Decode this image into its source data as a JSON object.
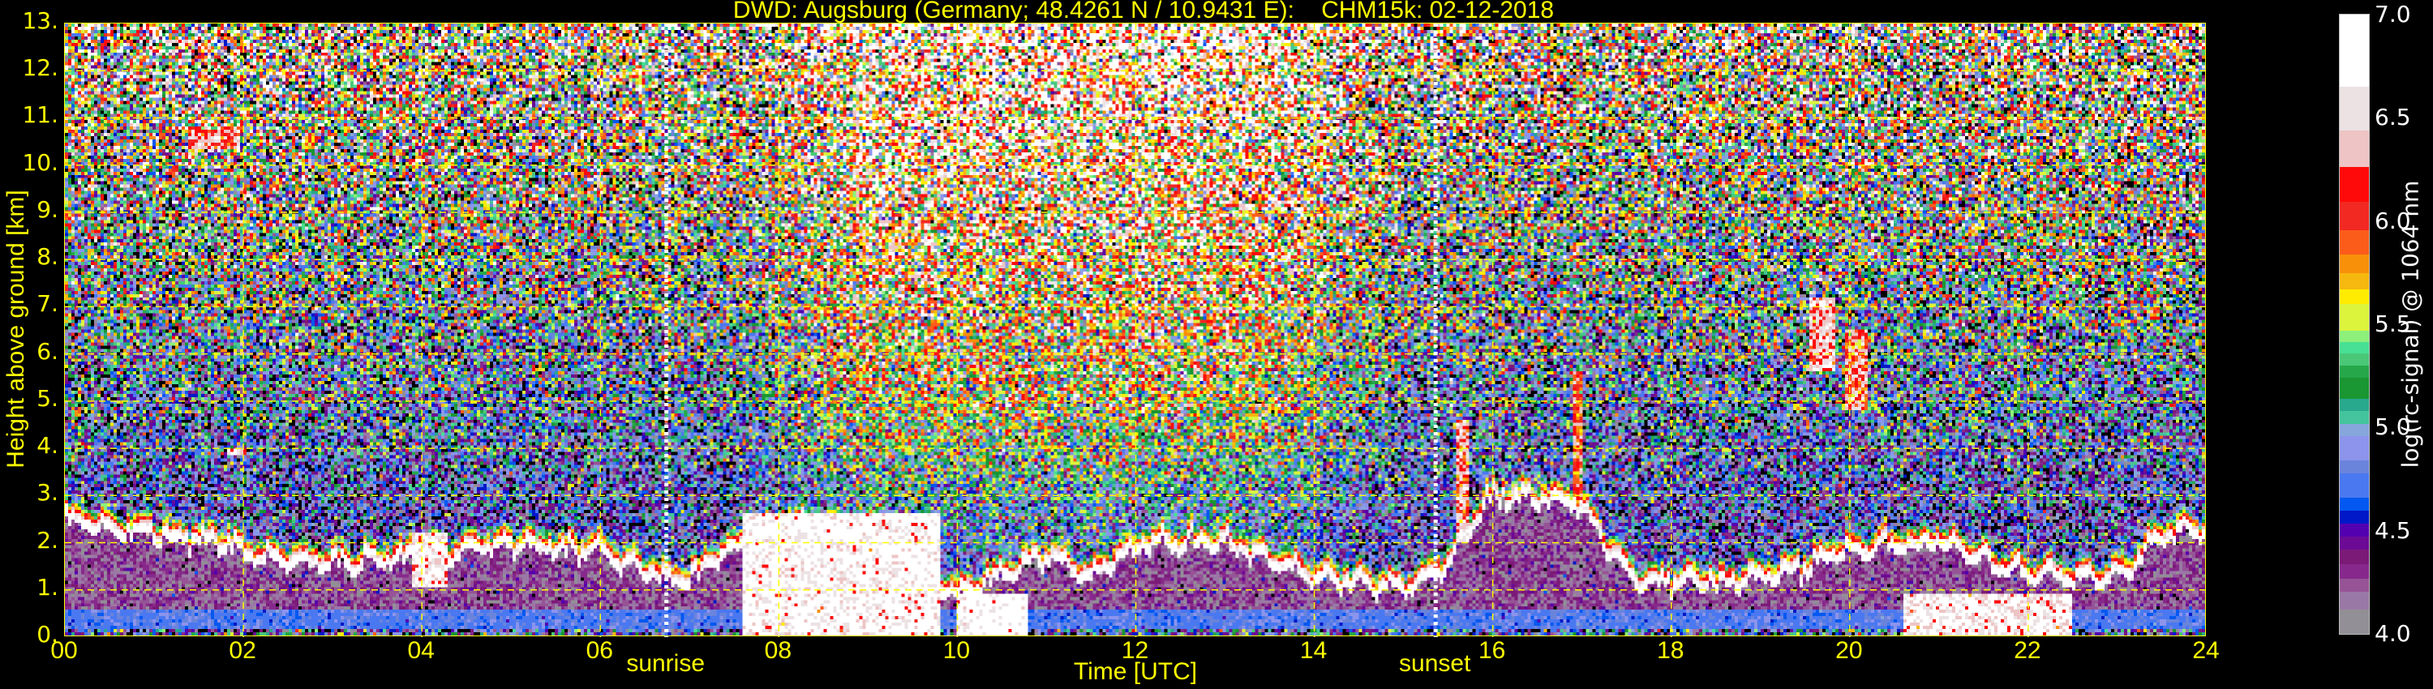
{
  "chart_data": {
    "type": "heatmap",
    "title": "DWD: Augsburg (Germany; 48.4261 N / 10.9431 E):    CHM15k: 02-12-2018",
    "xlabel": "Time [UTC]",
    "ylabel": "Height above ground [km]",
    "xlim": [
      0,
      24
    ],
    "ylim": [
      0,
      13
    ],
    "x_ticks": [
      "00",
      "02",
      "04",
      "06",
      "08",
      "10",
      "12",
      "14",
      "16",
      "18",
      "20",
      "22",
      "24"
    ],
    "y_ticks": [
      "0.",
      "1.",
      "2.",
      "3.",
      "4.",
      "5.",
      "6.",
      "7.",
      "8.",
      "9.",
      "10.",
      "11.",
      "12.",
      "13."
    ],
    "grid": true,
    "grid_color": "#ffff00",
    "markers": [
      {
        "label": "sunrise",
        "time_h": 6.74
      },
      {
        "label": "sunset",
        "time_h": 15.36
      }
    ],
    "colorbar": {
      "label": "log(rc-signal) @ 1064 nm",
      "range": [
        4.0,
        7.0
      ],
      "ticks": [
        "4.0",
        "4.5",
        "5.0",
        "5.5",
        "6.0",
        "6.5",
        "7.0"
      ],
      "bounds": [
        4.0,
        4.118,
        4.204,
        4.268,
        4.337,
        4.408,
        4.472,
        4.536,
        4.597,
        4.659,
        4.779,
        4.841,
        4.959,
        5.019,
        5.079,
        5.137,
        5.24,
        5.298,
        5.358,
        5.412,
        5.47,
        5.599,
        5.667,
        5.749,
        5.839,
        5.957,
        6.092,
        6.26,
        6.44,
        6.65,
        7.0
      ],
      "colors": [
        "#928f96",
        "#9a78a6",
        "#965496",
        "#87298c",
        "#7c1a78",
        "#6c0a96",
        "#5300b0",
        "#0018c8",
        "#0258f0",
        "#4a78f0",
        "#6a84dc",
        "#8c94ec",
        "#86a6dc",
        "#44c49c",
        "#28a88c",
        "#1a9632",
        "#26a84a",
        "#4ac878",
        "#48e094",
        "#8cf07a",
        "#dcf43c",
        "#ffec00",
        "#f6b80e",
        "#f8900a",
        "#fc5c1a",
        "#f22822",
        "#ff0a0a",
        "#eec4c4",
        "#ece2e4",
        "#ffffff"
      ],
      "below_range_color": "#000000"
    },
    "boundary_layer_top_km": {
      "time_h": [
        0,
        1,
        1.8,
        2,
        3,
        4,
        5,
        6,
        6.7,
        7,
        7.5,
        8,
        9,
        10,
        11,
        11.5,
        12,
        13,
        14,
        15,
        15.5,
        16,
        17,
        17.6,
        18,
        19,
        20,
        21,
        22,
        23,
        23.5,
        24
      ],
      "height_km": [
        2.4,
        2.1,
        2.0,
        1.7,
        1.5,
        1.7,
        1.9,
        1.8,
        1.2,
        1.2,
        1.9,
        2.3,
        2.2,
        0.9,
        1.7,
        1.2,
        1.9,
        2.0,
        1.2,
        1.0,
        1.4,
        3.0,
        2.8,
        1.1,
        1.1,
        1.2,
        1.8,
        2.0,
        1.3,
        1.2,
        2.1,
        2.2
      ]
    },
    "features": [
      {
        "kind": "aerosol-dense",
        "time_h": [
          7.6,
          9.8
        ],
        "height_km": [
          0.0,
          2.6
        ],
        "log_signal": 6.8
      },
      {
        "kind": "aerosol-dense",
        "time_h": [
          10.0,
          10.8
        ],
        "height_km": [
          0.0,
          0.9
        ],
        "log_signal": 6.9
      },
      {
        "kind": "aerosol-dense",
        "time_h": [
          20.6,
          22.5
        ],
        "height_km": [
          0.0,
          0.9
        ],
        "log_signal": 6.7
      },
      {
        "kind": "aerosol-dense",
        "time_h": [
          3.9,
          4.3
        ],
        "height_km": [
          1.0,
          2.2
        ],
        "log_signal": 6.6
      },
      {
        "kind": "cloud",
        "time_h": [
          1.4,
          1.95
        ],
        "height_km": [
          10.3,
          10.8
        ],
        "log_signal": 6.2
      },
      {
        "kind": "cloud",
        "time_h": [
          1.8,
          2.05
        ],
        "height_km": [
          3.85,
          4.0
        ],
        "log_signal": 6.5
      },
      {
        "kind": "cloud",
        "time_h": [
          15.6,
          15.75
        ],
        "height_km": [
          2.0,
          4.6
        ],
        "log_signal": 6.3
      },
      {
        "kind": "cloud",
        "time_h": [
          19.55,
          19.85
        ],
        "height_km": [
          5.6,
          7.2
        ],
        "log_signal": 6.4
      },
      {
        "kind": "cloud",
        "time_h": [
          19.95,
          20.2
        ],
        "height_km": [
          4.8,
          6.5
        ],
        "log_signal": 6.2
      },
      {
        "kind": "cloud",
        "time_h": [
          16.9,
          17.0
        ],
        "height_km": [
          2.8,
          5.6
        ],
        "log_signal": 6.0
      },
      {
        "kind": "cloud",
        "time_h": [
          23.4,
          23.5
        ],
        "height_km": [
          6.7,
          7.0
        ],
        "log_signal": 5.8
      }
    ]
  }
}
